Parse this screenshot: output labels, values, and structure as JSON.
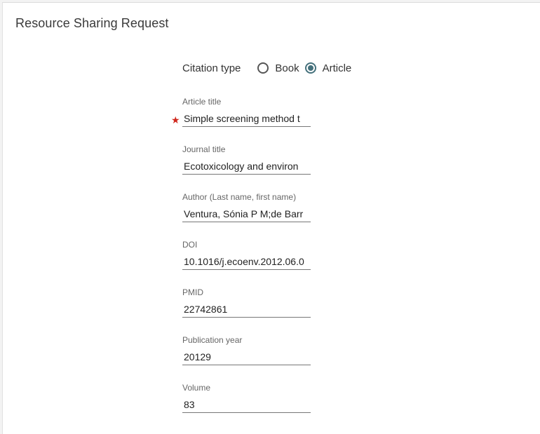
{
  "header": {
    "title": "Resource Sharing Request"
  },
  "citation": {
    "label": "Citation type",
    "options": [
      {
        "label": "Book",
        "selected": false
      },
      {
        "label": "Article",
        "selected": true
      }
    ]
  },
  "required_marker": "★",
  "fields": {
    "article_title": {
      "label": "Article title",
      "value": "Simple screening method t"
    },
    "journal_title": {
      "label": "Journal title",
      "value": "Ecotoxicology and environ"
    },
    "author": {
      "label": "Author (Last name, first name)",
      "value": "Ventura, Sónia P M;de Barr"
    },
    "doi": {
      "label": "DOI",
      "value": "10.1016/j.ecoenv.2012.06.0"
    },
    "pmid": {
      "label": "PMID",
      "value": "22742861"
    },
    "publication_year": {
      "label": "Publication year",
      "value": "20129"
    },
    "volume": {
      "label": "Volume",
      "value": "83"
    }
  },
  "colors": {
    "accent": "#44707b",
    "required": "#d0271d"
  }
}
